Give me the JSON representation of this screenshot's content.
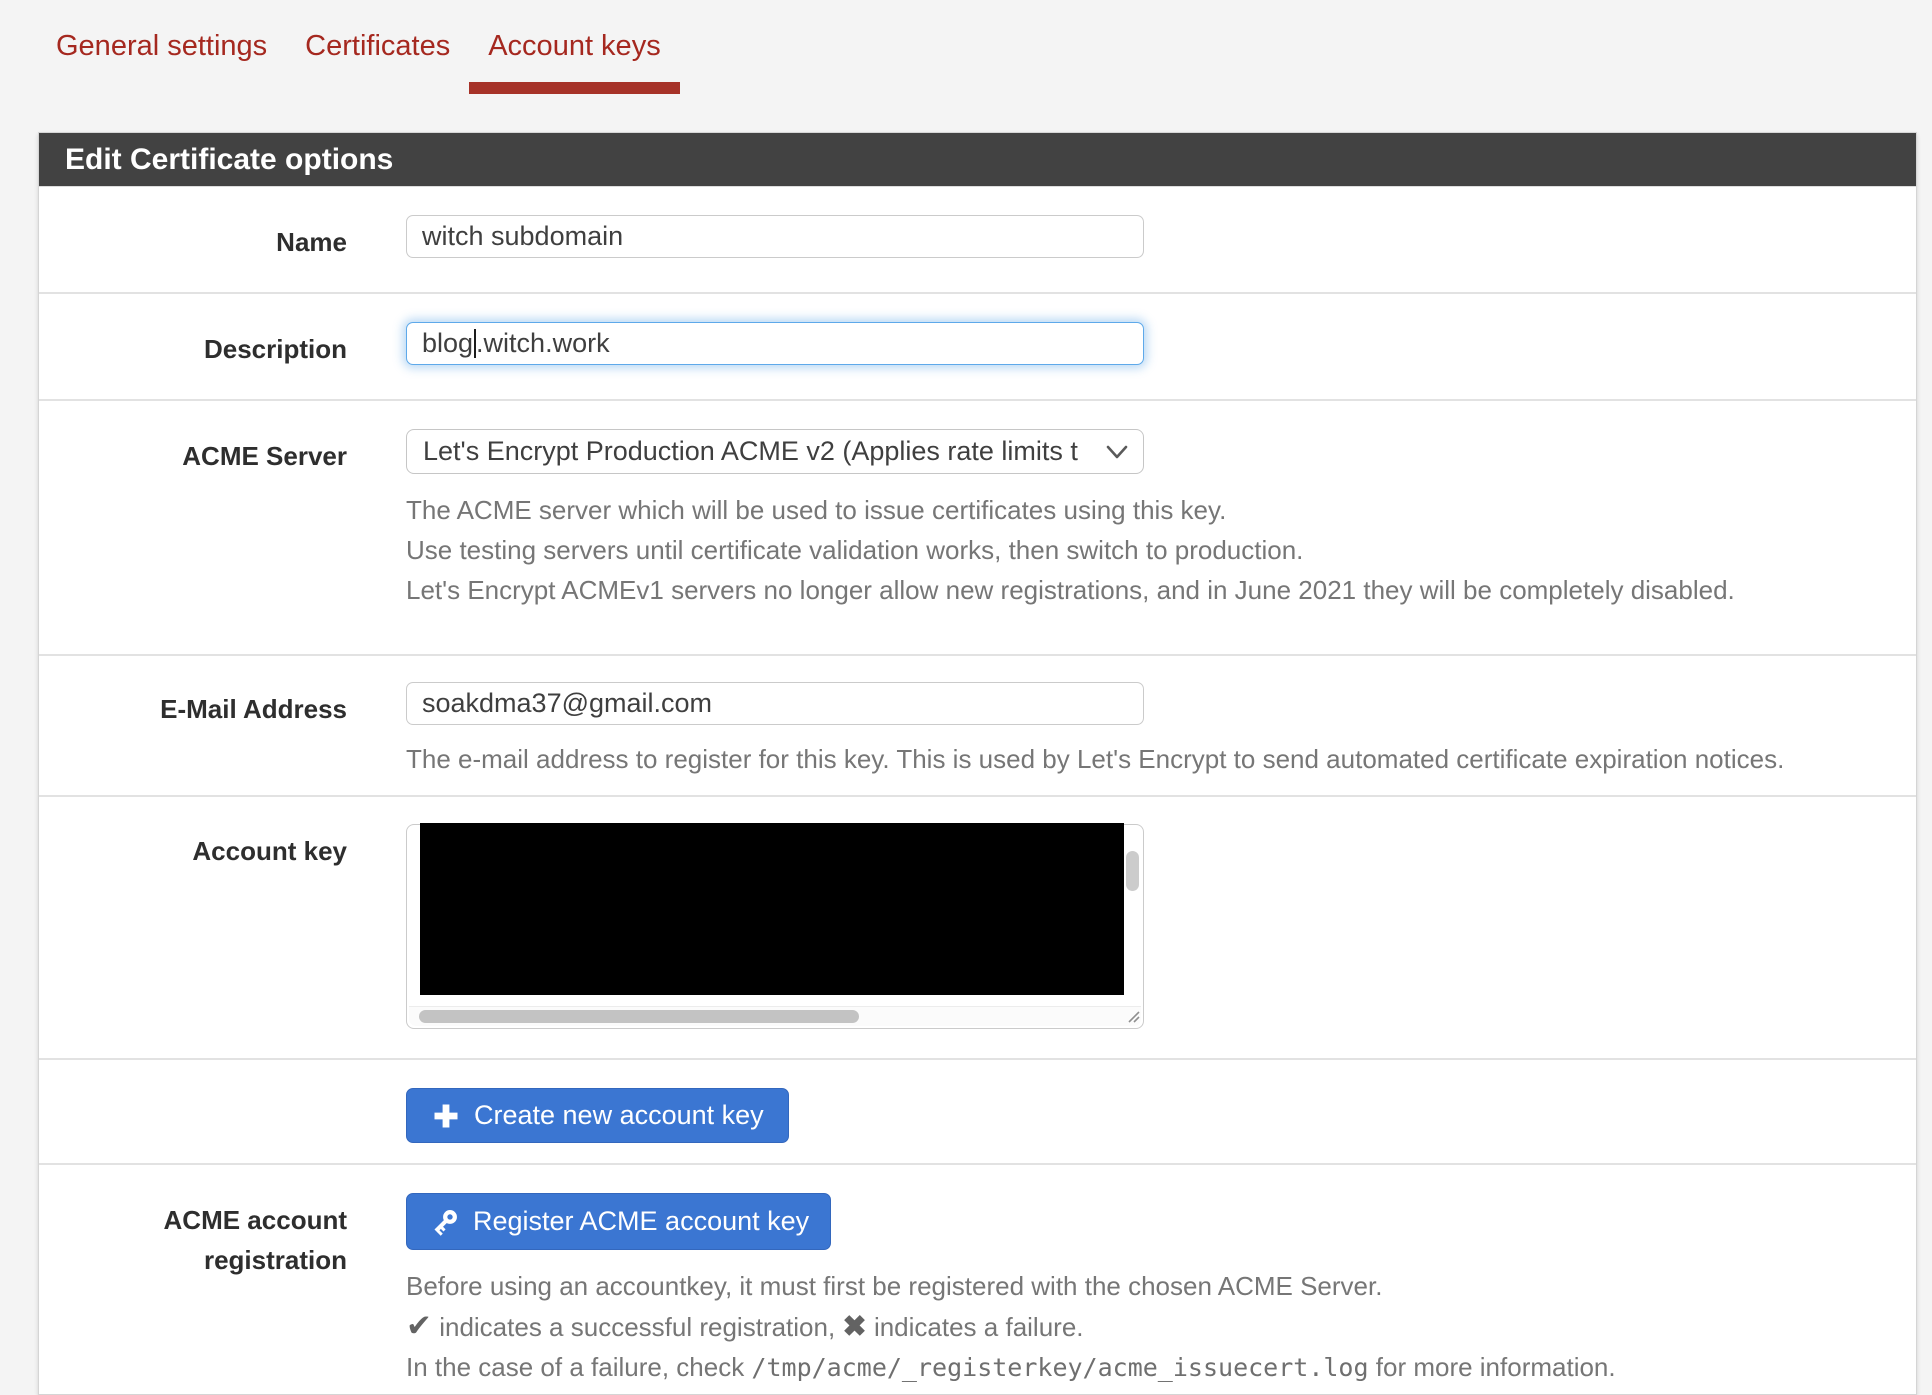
{
  "colors": {
    "accent_red": "#a5281f",
    "tab_underline": "#a63228",
    "panel_header_bg": "#424242",
    "button_blue": "#3b76d2",
    "focus_ring_blue": "#5ea9ea",
    "help_text_gray": "#767676",
    "page_bg": "#f4f4f4"
  },
  "tabs": {
    "items": [
      {
        "label": "General settings",
        "active": false
      },
      {
        "label": "Certificates",
        "active": false
      },
      {
        "label": "Account keys",
        "active": true
      }
    ]
  },
  "panel": {
    "title": "Edit Certificate options",
    "rows": {
      "name": {
        "label": "Name",
        "value": "witch subdomain"
      },
      "description": {
        "label": "Description",
        "value_before_caret": "blog",
        "value_after_caret": ".witch.work"
      },
      "acme_server": {
        "label": "ACME Server",
        "selected_option": "Let's Encrypt Production ACME v2 (Applies rate limits t",
        "help": [
          "The ACME server which will be used to issue certificates using this key.",
          "Use testing servers until certificate validation works, then switch to production.",
          "Let's Encrypt ACMEv1 servers no longer allow new registrations, and in June 2021 they will be completely disabled."
        ]
      },
      "email": {
        "label": "E-Mail Address",
        "value": "soakdma37@gmail.com",
        "help": "The e-mail address to register for this key. This is used by Let's Encrypt to send automated certificate expiration notices."
      },
      "account_key": {
        "label": "Account key"
      },
      "create_key": {
        "button_label": "Create new account key"
      },
      "registration": {
        "label_line1": "ACME account",
        "label_line2": "registration",
        "button_label": "Register ACME account key",
        "help_line1": "Before using an accountkey, it must first be registered with the chosen ACME Server.",
        "success_icon": "✔",
        "help_line2_mid": " indicates a successful registration, ",
        "failure_icon": "✖",
        "help_line2_end": " indicates a failure.",
        "help_line3_pre": "In the case of a failure, check ",
        "help_line3_code": "/tmp/acme/_registerkey/acme_issuecert.log",
        "help_line3_post": " for more information."
      }
    }
  }
}
